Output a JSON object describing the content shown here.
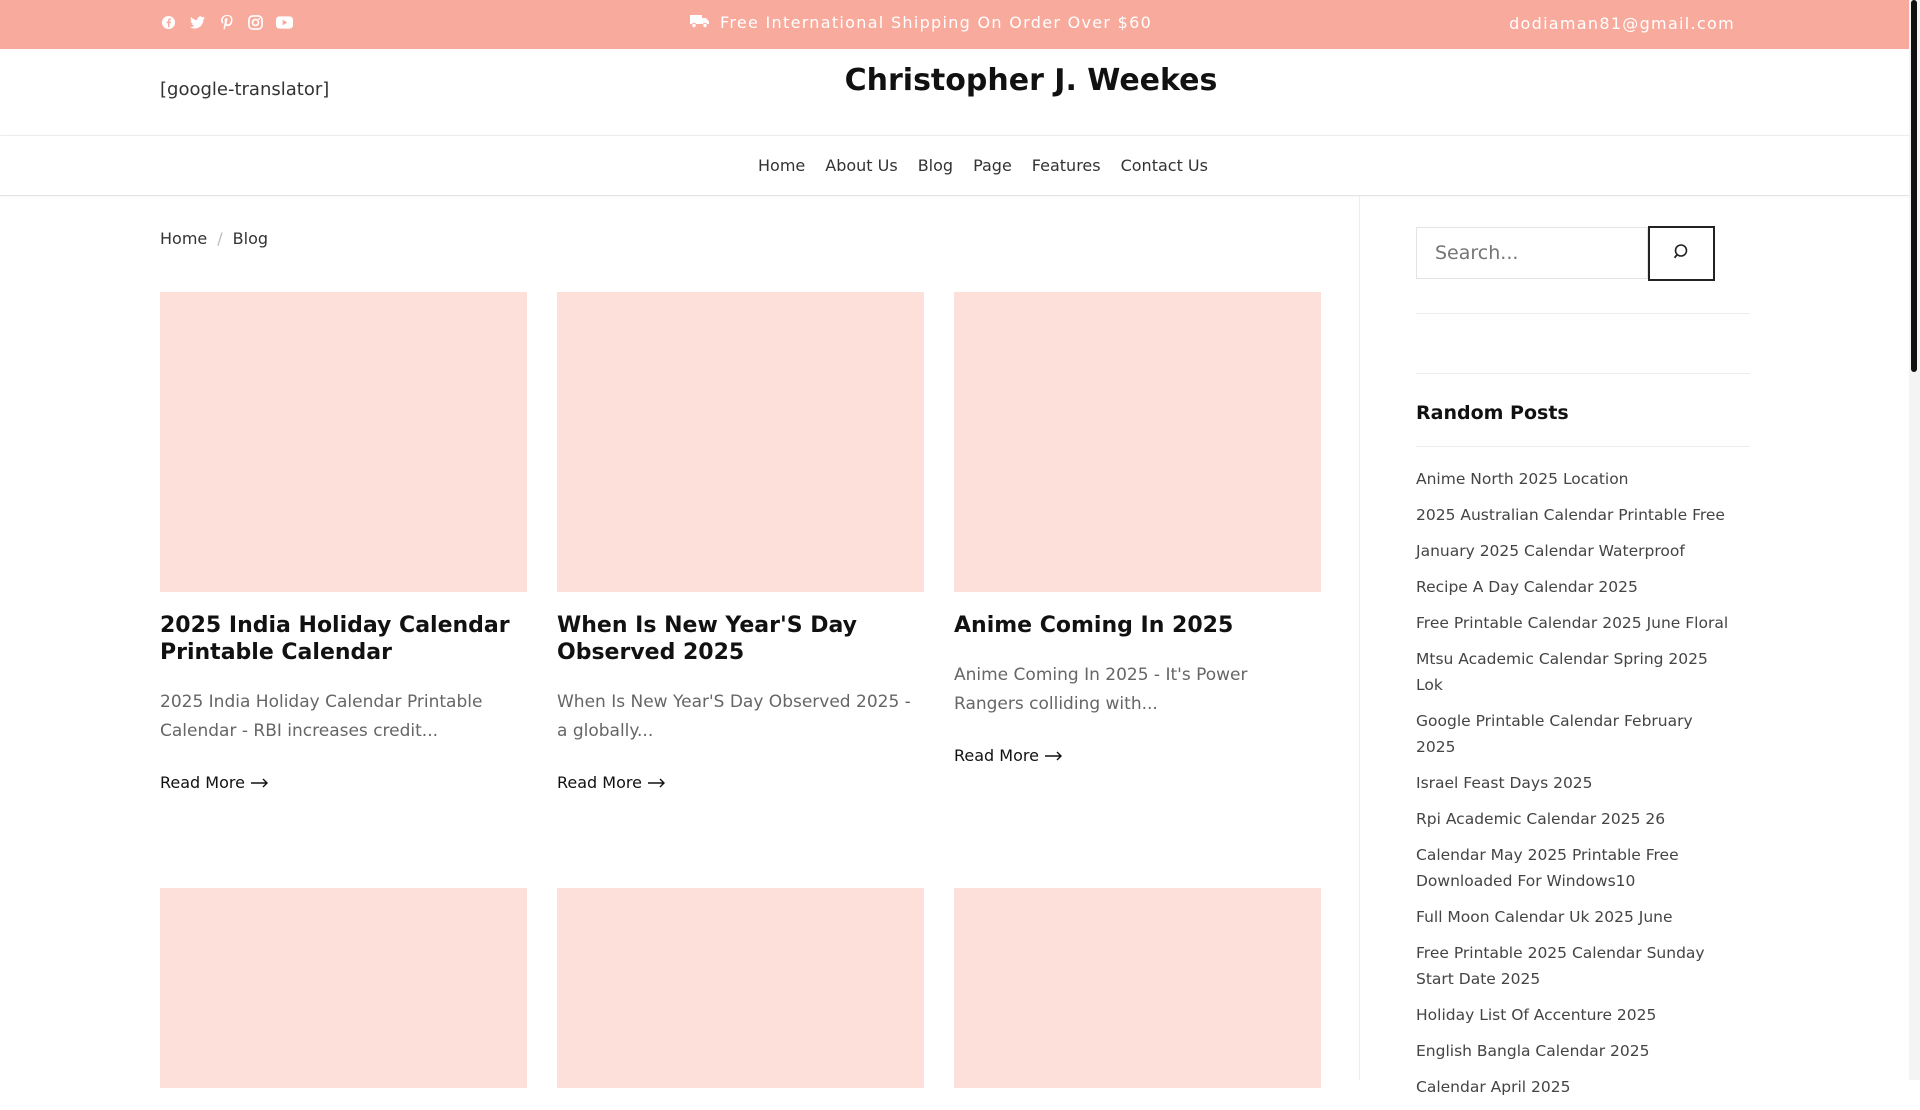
{
  "topbar": {
    "social_icons": [
      "facebook-icon",
      "twitter-icon",
      "pinterest-icon",
      "instagram-icon",
      "youtube-icon"
    ],
    "shipping_text": "Free International Shipping On Order Over $60",
    "email": "dodiaman81@gmail.com",
    "background": "#f8aa9d"
  },
  "header": {
    "translator": "[google-translator]",
    "site_title": "Christopher J. Weekes"
  },
  "nav": {
    "items": [
      "Home",
      "About Us",
      "Blog",
      "Page",
      "Features",
      "Contact Us"
    ]
  },
  "breadcrumb": {
    "home": "Home",
    "separator": "/",
    "current": "Blog"
  },
  "posts": [
    {
      "title": "2025 India Holiday Calendar Printable Calendar",
      "excerpt": "2025 India Holiday Calendar Printable Calendar - RBI increases credit...",
      "read_more": "Read More"
    },
    {
      "title": "When Is New Year'S Day Observed 2025",
      "excerpt": "When Is New Year'S Day Observed 2025 - a globally...",
      "read_more": "Read More"
    },
    {
      "title": "Anime Coming In 2025",
      "excerpt": "Anime Coming In 2025 - It's Power Rangers colliding with...",
      "read_more": "Read More"
    }
  ],
  "sidebar": {
    "search_placeholder": "Search...",
    "random_posts_title": "Random Posts",
    "random_posts": [
      "Anime North 2025 Location",
      "2025 Australian Calendar Printable Free",
      "January 2025 Calendar Waterproof",
      "Recipe A Day Calendar 2025",
      "Free Printable Calendar 2025 June Floral",
      "Mtsu Academic Calendar Spring 2025 Lok",
      "Google Printable Calendar February 2025",
      "Israel Feast Days 2025",
      "Rpi Academic Calendar 2025 26",
      "Calendar May 2025 Printable Free Downloaded For Windows10",
      "Full Moon Calendar Uk 2025 June",
      "Free Printable 2025 Calendar Sunday Start Date 2025",
      "Holiday List Of Accenture 2025",
      "English Bangla Calendar 2025",
      "Calendar April 2025"
    ]
  },
  "colors": {
    "accent": "#f8aa9d",
    "thumbnail": "#fee0da"
  }
}
